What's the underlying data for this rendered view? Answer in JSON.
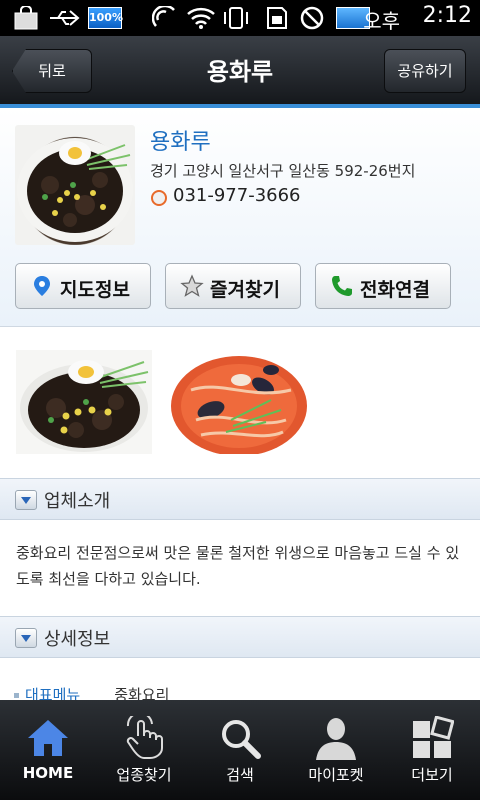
{
  "status_bar": {
    "ampm": "오후",
    "time": "2:12",
    "battery_label": "100%"
  },
  "header": {
    "back_label": "뒤로",
    "title": "용화루",
    "share_label": "공유하기"
  },
  "business": {
    "name": "용화루",
    "address": "경기 고양시 일산서구 일산동 592-26번지",
    "phone": "031-977-3666"
  },
  "actions": {
    "map_label": "지도정보",
    "favorite_label": "즐겨찾기",
    "call_label": "전화연결"
  },
  "sections": {
    "intro_title": "업체소개",
    "intro_text": "중화요리 전문점으로써 맛은 물론 철저한 위생으로 마음놓고 드실 수 있도록 최선을 다하고 있습니다.",
    "detail_title": "상세정보",
    "detail_key": "대표메뉴",
    "detail_value": "중화요리"
  },
  "nav": {
    "items": [
      {
        "label": "HOME",
        "icon": "home-icon"
      },
      {
        "label": "업종찾기",
        "icon": "touch-icon"
      },
      {
        "label": "검색",
        "icon": "search-icon"
      },
      {
        "label": "마이포켓",
        "icon": "person-icon"
      },
      {
        "label": "더보기",
        "icon": "more-icon"
      }
    ]
  },
  "colors": {
    "accent": "#3a8fd8",
    "link": "#1f6fc0"
  }
}
